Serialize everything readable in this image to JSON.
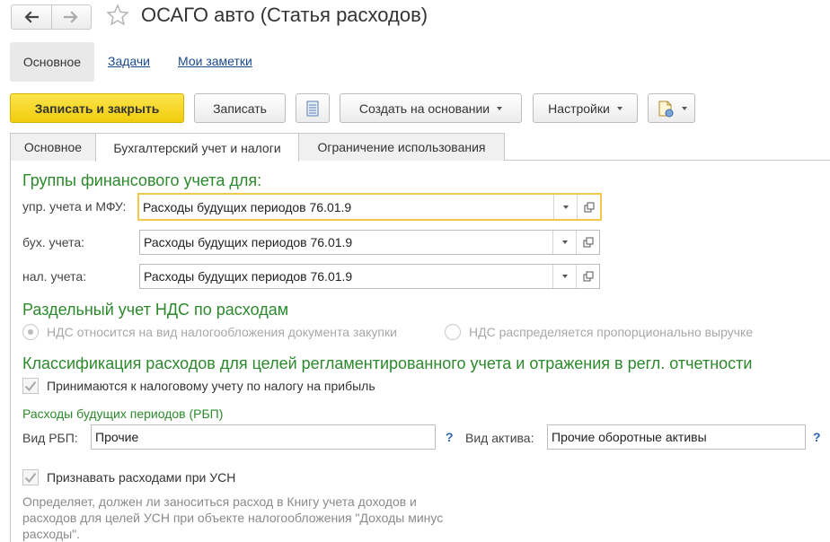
{
  "window": {
    "title": "ОСАГО авто (Статья расходов)"
  },
  "page_nav": {
    "items": [
      "Основное",
      "Задачи",
      "Мои заметки"
    ]
  },
  "toolbar": {
    "save_close": "Записать и закрыть",
    "save": "Записать",
    "create_based": "Создать на основании",
    "settings": "Настройки"
  },
  "tabs": [
    "Основное",
    "Бухгалтерский учет и налоги",
    "Ограничение использования"
  ],
  "fin_groups": {
    "header": "Группы финансового учета для:",
    "rows": [
      {
        "label": "упр. учета и МФУ:",
        "value": "Расходы будущих периодов 76.01.9"
      },
      {
        "label": "бух. учета:",
        "value": "Расходы будущих периодов 76.01.9"
      },
      {
        "label": "нал. учета:",
        "value": "Расходы будущих периодов 76.01.9"
      }
    ]
  },
  "vat": {
    "header": "Раздельный учет НДС по расходам",
    "options": [
      "НДС относится на вид налогообложения документа закупки",
      "НДС распределяется пропорционально выручке"
    ],
    "selected": 0
  },
  "classification": {
    "header": "Классификация расходов для целей регламентированного учета и отражения в регл. отчетности",
    "profit_tax_label": "Принимаются к налоговому учету по налогу на прибыль",
    "profit_tax_checked": true,
    "rbp_header": "Расходы будущих периодов (РБП)",
    "rbp_type_label": "Вид РБП:",
    "rbp_type_value": "Прочие",
    "asset_type_label": "Вид актива:",
    "asset_type_value": "Прочие оборотные активы",
    "help": "?",
    "usn_label": "Признавать расходами при УСН",
    "usn_checked": true,
    "usn_note": "Определяет, должен ли заноситься расход в Книгу учета доходов и расходов для целей УСН при объекте налогообложения \"Доходы минус расходы\"."
  },
  "icons": {
    "back": "arrow-left-icon",
    "forward": "arrow-right-icon",
    "favorite": "star-icon",
    "list": "list-icon",
    "report": "report-icon",
    "open": "open-window-icon",
    "dropdown": "chevron-down-icon"
  },
  "colors": {
    "primary_button": "#f2cc0c",
    "section_header": "#2c8a2c",
    "link": "#1a4a8a",
    "focus_border": "#f2c84b",
    "help": "#2a64b4"
  }
}
